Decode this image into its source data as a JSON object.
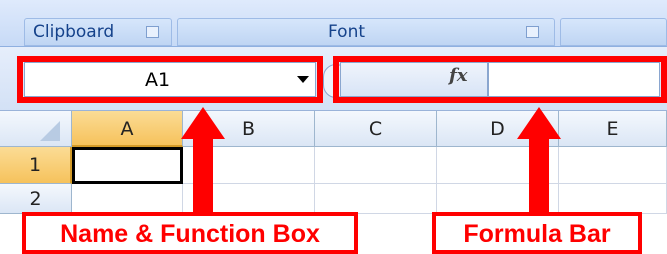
{
  "ribbon": {
    "groups": [
      {
        "label": "Clipboard",
        "has_launcher": true
      },
      {
        "label": "Font",
        "has_launcher": true
      }
    ]
  },
  "formula_bar": {
    "name_box_value": "A1",
    "fx_symbol": "fx",
    "formula_value": ""
  },
  "grid": {
    "columns": [
      "A",
      "B",
      "C",
      "D",
      "E"
    ],
    "rows": [
      "1",
      "2"
    ],
    "active_cell": "A1",
    "active_column": "A",
    "active_row": "1"
  },
  "annotations": {
    "name_box_callout": "Name & Function Box",
    "formula_bar_callout": "Formula Bar",
    "highlight_color": "#ff0000"
  },
  "colors": {
    "ribbon_text": "#15428b",
    "active_header": "#f6c25c",
    "gridline": "#d0d7e5"
  }
}
